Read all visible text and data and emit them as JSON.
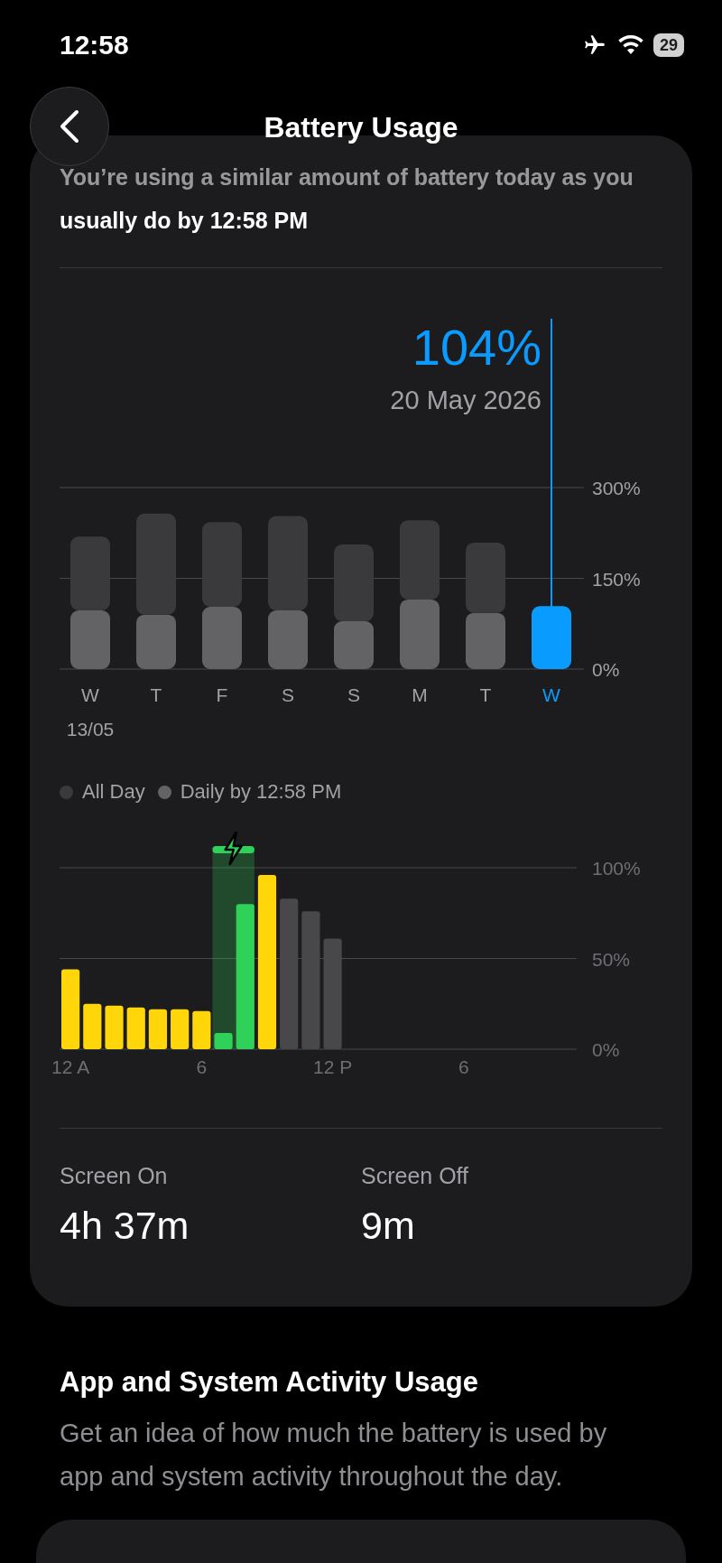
{
  "status_bar": {
    "time": "12:58",
    "battery": "29"
  },
  "nav": {
    "title": "Battery Usage"
  },
  "usage_card": {
    "summary": "You’re using a similar amount of battery today as you usually do by 12:58 PM",
    "weekly_chart": {
      "selection": {
        "value": "104%",
        "date": "20 May 2026"
      },
      "bars": [
        {
          "selected": false
        },
        {
          "selected": false
        },
        {
          "selected": false
        },
        {
          "selected": false
        },
        {
          "selected": false
        },
        {
          "selected": false
        },
        {
          "selected": false
        },
        {
          "selected": true
        }
      ],
      "first_date": "13/05",
      "chart_data": {
        "type": "bar",
        "stacked": true,
        "categories": [
          "W",
          "T",
          "F",
          "S",
          "S",
          "M",
          "T",
          "W"
        ],
        "series": [
          {
            "name": "Daily by 12:58 PM",
            "color": "#636366",
            "values": [
              97,
              90,
              103,
              97,
              79,
              115,
              93,
              null
            ]
          },
          {
            "name": "All Day",
            "color": "#3a3a3c",
            "values": [
              122,
              167,
              140,
              156,
              127,
              131,
              116,
              null
            ]
          },
          {
            "color": "#0a9bff",
            "values": [
              null,
              null,
              null,
              null,
              null,
              null,
              null,
              104
            ]
          }
        ],
        "ylim": [
          0,
          300
        ],
        "yticks": [
          {
            "value": 0,
            "label": "0%"
          },
          {
            "value": 150,
            "label": "150%"
          },
          {
            "value": 300,
            "label": "300%"
          }
        ]
      }
    },
    "hourly_chart": {
      "charging_band": {
        "color": "#30d158"
      },
      "chart_data": {
        "type": "bar",
        "categories": [
          "12 A",
          null,
          null,
          null,
          null,
          null,
          "6",
          null,
          null,
          null,
          null,
          null,
          "12 P",
          null,
          null,
          null,
          null,
          null,
          "6",
          null,
          null,
          null,
          null,
          null
        ],
        "series": [
          {
            "color": "#ffd60a",
            "values": [
              44,
              25,
              24,
              23,
              22,
              22,
              21,
              null,
              null,
              96,
              null,
              null,
              null,
              null,
              null,
              null,
              null,
              null,
              null,
              null,
              null,
              null,
              null,
              null
            ]
          },
          {
            "color": "#30d158",
            "values": [
              null,
              null,
              null,
              null,
              null,
              null,
              null,
              9,
              80,
              null,
              null,
              null,
              null,
              null,
              null,
              null,
              null,
              null,
              null,
              null,
              null,
              null,
              null,
              null
            ]
          },
          {
            "color": "#48484a",
            "values": [
              null,
              null,
              null,
              null,
              null,
              null,
              null,
              null,
              null,
              null,
              83,
              76,
              61,
              null,
              null,
              null,
              null,
              null,
              null,
              null,
              null,
              null,
              null,
              null
            ]
          }
        ],
        "ylim": [
          0,
          100
        ],
        "yticks": [
          {
            "value": 0,
            "label": "0%"
          },
          {
            "value": 50,
            "label": "50%"
          },
          {
            "value": 100,
            "label": "100%"
          }
        ]
      }
    },
    "stats": [
      {
        "label": "Screen On",
        "value": "4h 37m"
      },
      {
        "label": "Screen Off",
        "value": "9m"
      }
    ]
  },
  "activity_section": {
    "heading": "App and System Activity Usage",
    "description": "Get an idea of how much the battery is used by app and system activity throughout the day."
  }
}
